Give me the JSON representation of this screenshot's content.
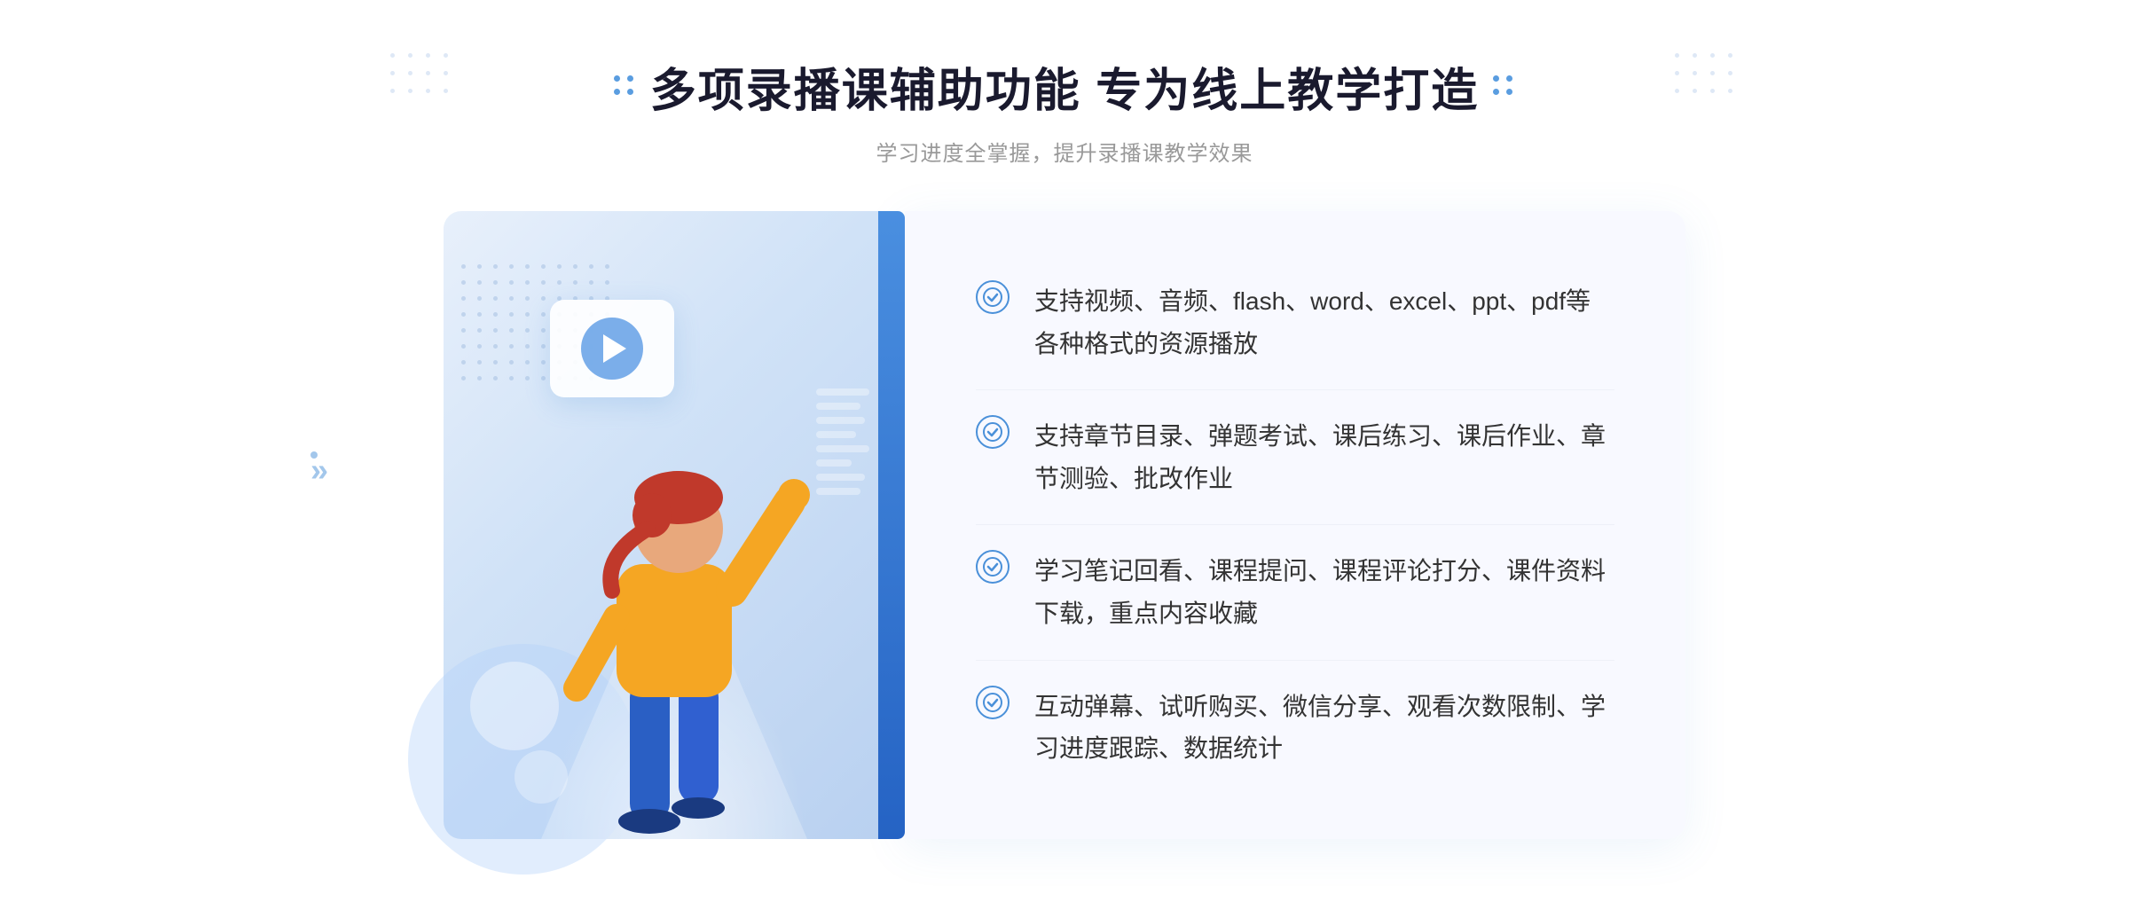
{
  "header": {
    "title": "多项录播课辅助功能 专为线上教学打造",
    "subtitle": "学习进度全掌握，提升录播课教学效果"
  },
  "features": [
    {
      "id": 1,
      "text": "支持视频、音频、flash、word、excel、ppt、pdf等各种格式的资源播放"
    },
    {
      "id": 2,
      "text": "支持章节目录、弹题考试、课后练习、课后作业、章节测验、批改作业"
    },
    {
      "id": 3,
      "text": "学习笔记回看、课程提问、课程评论打分、课件资料下载，重点内容收藏"
    },
    {
      "id": 4,
      "text": "互动弹幕、试听购买、微信分享、观看次数限制、学习进度跟踪、数据统计"
    }
  ],
  "colors": {
    "primary": "#4a90d9",
    "title": "#1a1a2e",
    "text": "#333333",
    "subtitle": "#999999",
    "background": "#ffffff",
    "panel_bg": "#f8f9ff"
  },
  "icons": {
    "check": "✓",
    "play": "▶",
    "chevron": "»"
  }
}
